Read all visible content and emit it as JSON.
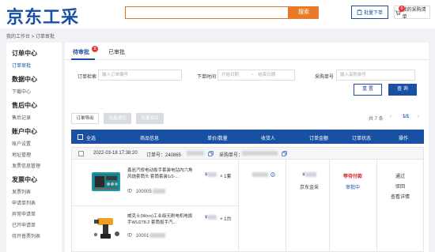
{
  "header": {
    "logo": "京东工采",
    "search_button": "搜索",
    "batch_order": "批量下单",
    "cart": "我的采购清单",
    "cart_count": "0"
  },
  "breadcrumb": "我的工作台 > 订单审批",
  "sidebar": [
    {
      "title": "订单中心",
      "items": [
        {
          "label": "订单审批",
          "active": true
        }
      ]
    },
    {
      "title": "数据中心",
      "items": [
        {
          "label": "下载中心"
        }
      ]
    },
    {
      "title": "售后中心",
      "items": [
        {
          "label": "售后记录"
        }
      ]
    },
    {
      "title": "账户中心",
      "items": [
        {
          "label": "账户设置"
        },
        {
          "label": "地址管理"
        },
        {
          "label": "发票信息管理"
        }
      ]
    },
    {
      "title": "发票中心",
      "items": [
        {
          "label": "发票列表"
        },
        {
          "label": "申请单列表"
        },
        {
          "label": "异常申请单"
        },
        {
          "label": "已开申请单"
        },
        {
          "label": "待开普票列表"
        }
      ]
    }
  ],
  "tabs": {
    "pending": "待审批",
    "pending_count": "8",
    "approved": "已审批"
  },
  "filters": {
    "order_label": "订单检索",
    "order_placeholder": "输入订单编号",
    "time_label": "下单时间",
    "start_placeholder": "开始日期",
    "date_sep": "~",
    "end_placeholder": "结束日期",
    "purchase_label": "采购单号",
    "purchase_placeholder": "输入采购单号",
    "reset": "重 置",
    "query": "查 询"
  },
  "toolbar": {
    "export": "订单导出",
    "batch_approve": "批量通过",
    "batch_reject": "批量驳回"
  },
  "pager": {
    "total": "共 7 条",
    "prev": "‹",
    "page": "1/1",
    "next": "›"
  },
  "table_headers": {
    "select_all": "全选",
    "product": "商品信息",
    "price_qty": "单价/数量",
    "receiver": "收货人",
    "amount": "订单金额",
    "status": "订单状态",
    "action": "操作"
  },
  "order": {
    "datetime": "2022-03-18 17:38:20",
    "order_no_label": "订单号：240865",
    "purchase_label": "采购单号：",
    "products": [
      {
        "name": "鑫岩汽修电动扳手套装电钻内六角风炮套筒头 套筒套装1/2-...",
        "id_label": "ID",
        "id": "100005",
        "price": "¥",
        "qty": "× 1套"
      },
      {
        "name": "威克士(Worx)工业级无刷电机电扳手WU278.2 套筒扳手汽...",
        "id_label": "ID",
        "id": "10001",
        "price": "¥",
        "qty": "× 1台"
      }
    ],
    "amount": "¥",
    "payment": "京东金采",
    "status": "等待付款",
    "approval": "审批中",
    "actions": {
      "approve": "通过",
      "reject": "驳回",
      "detail": "查看详情"
    }
  },
  "colors": {
    "brand": "#1a50a3",
    "accent": "#ea7a2a",
    "alert": "#d8232a"
  }
}
